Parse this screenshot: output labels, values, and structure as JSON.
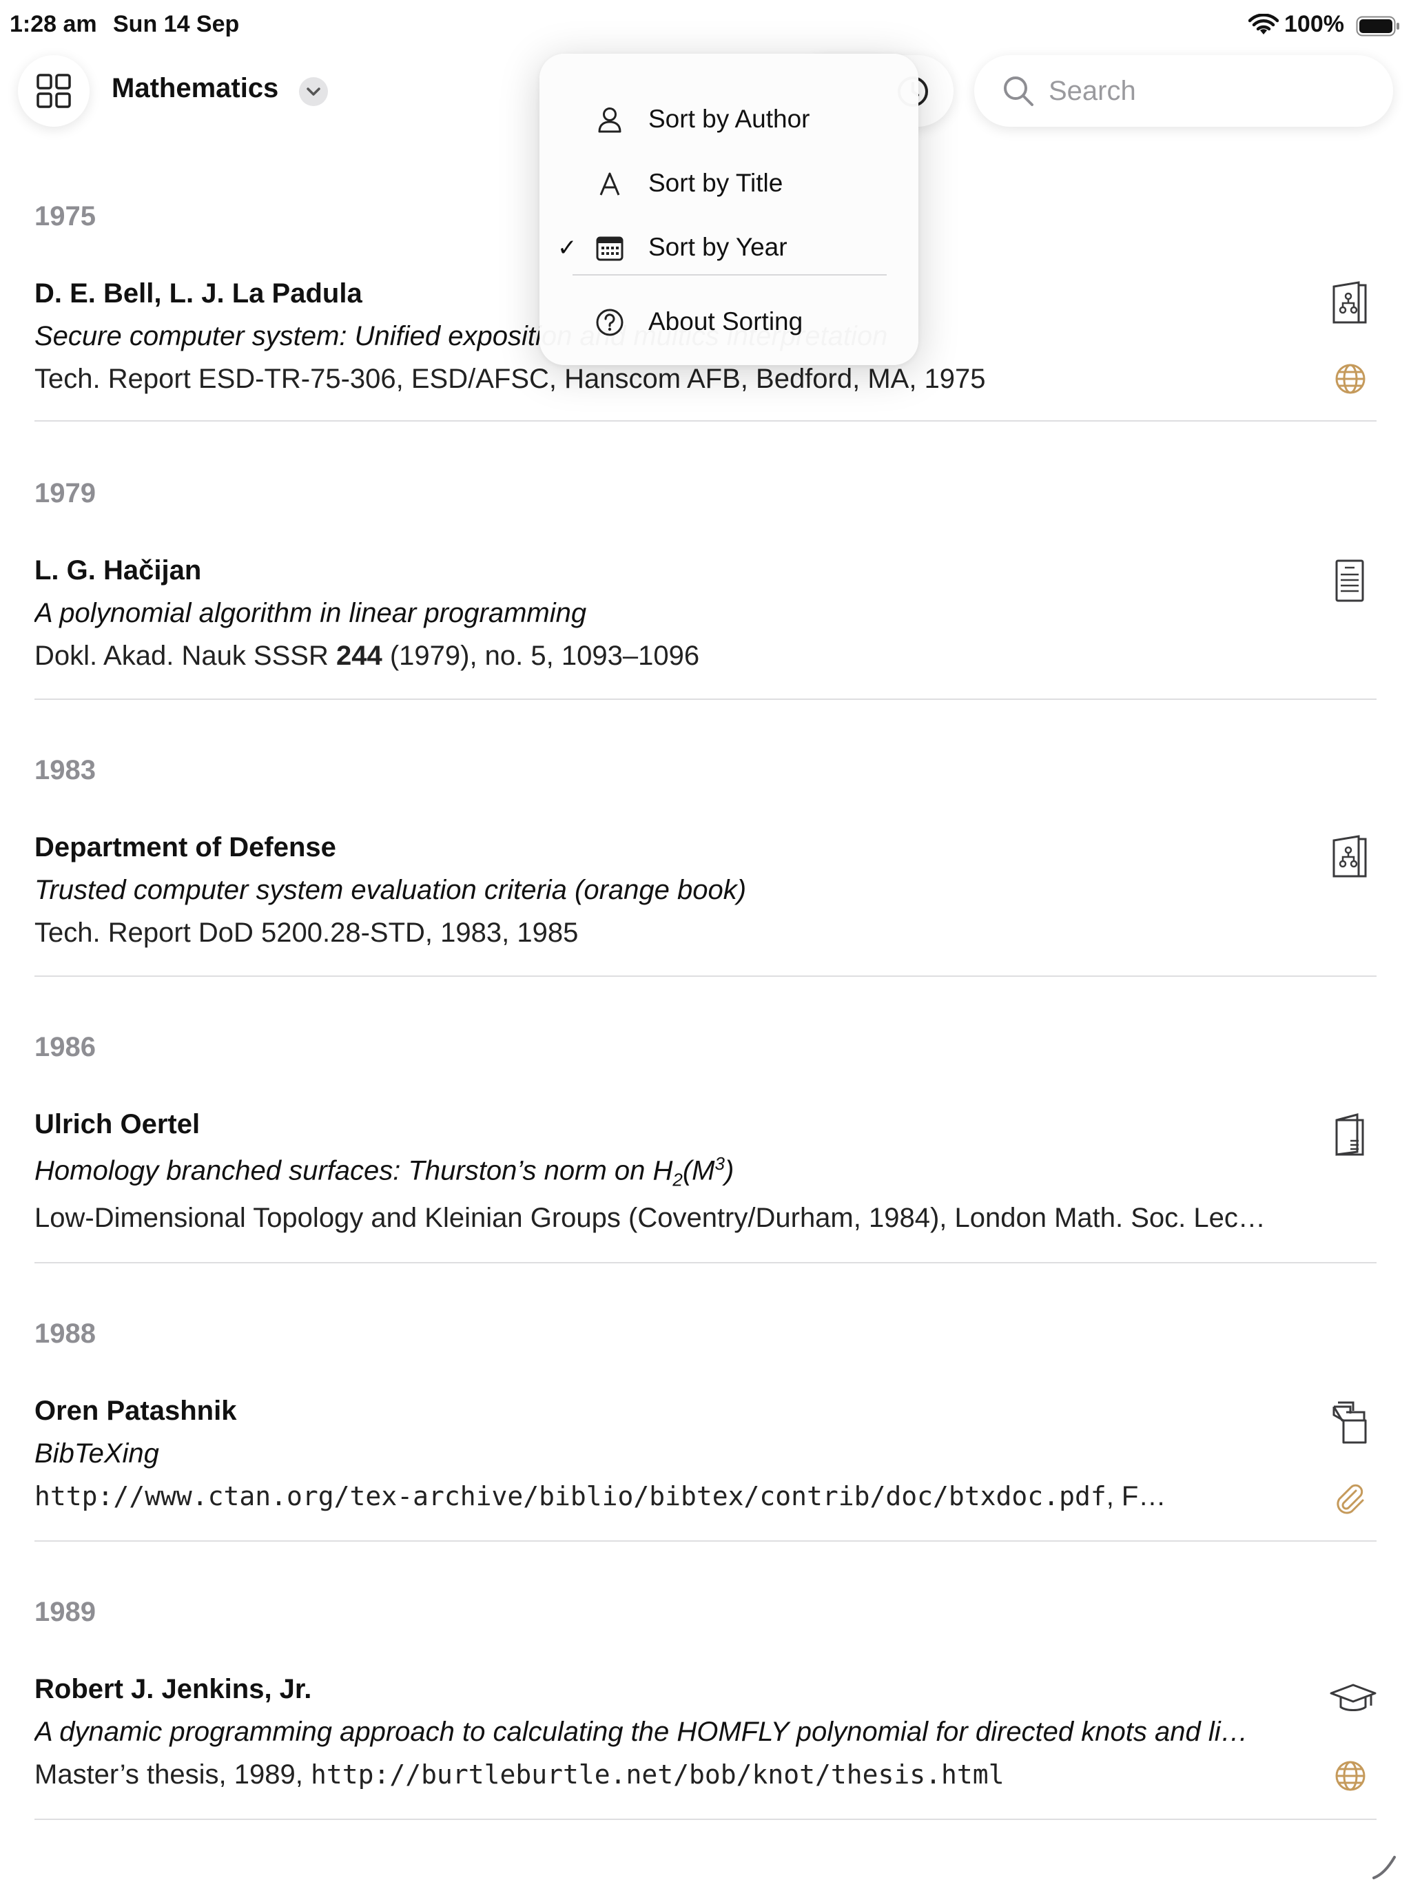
{
  "status_bar": {
    "time": "1:28 am",
    "date": "Sun 14 Sep",
    "battery": "100%"
  },
  "toolbar": {
    "collection_title": "Mathematics",
    "search_placeholder": "Search"
  },
  "sort_menu": {
    "items": [
      {
        "label": "Sort by Author",
        "icon": "person-icon",
        "checked": false
      },
      {
        "label": "Sort by Title",
        "icon": "letter-a-icon",
        "checked": false
      },
      {
        "label": "Sort by Year",
        "icon": "calendar-icon",
        "checked": true
      }
    ],
    "about_label": "About Sorting",
    "check_glyph": "✓"
  },
  "sections": [
    {
      "year": "1975",
      "entries": [
        {
          "author": "D. E. Bell, L. J. La Padula",
          "title": "Secure computer system: Unified exposition and multics interpretation",
          "detail": "Tech. Report ESD-TR-75-306, ESD/AFSC, Hanscom AFB, Bedford, MA, 1975",
          "type_icon": "report-icon",
          "link_icon": "globe-icon"
        }
      ]
    },
    {
      "year": "1979",
      "entries": [
        {
          "author": "L. G. Hačijan",
          "title": "A polynomial algorithm in linear programming",
          "detail_prefix": "Dokl. Akad. Nauk SSSR ",
          "detail_bold": "244",
          "detail_suffix": " (1979), no. 5, 1093–1096",
          "type_icon": "article-icon"
        }
      ]
    },
    {
      "year": "1983",
      "entries": [
        {
          "author": "Department of Defense",
          "title": "Trusted computer system evaluation criteria (orange book)",
          "detail": "Tech. Report DoD 5200.28-STD, 1983, 1985",
          "type_icon": "report-icon"
        }
      ]
    },
    {
      "year": "1986",
      "entries": [
        {
          "author": "Ulrich Oertel",
          "title_prefix": "Homology branched surfaces: Thurston’s norm on H",
          "title_sub": "2",
          "title_mid": "(M",
          "title_sup": "3",
          "title_suffix": ")",
          "detail": "Low-Dimensional Topology and Kleinian Groups (Coventry/Durham, 1984), London Math. Soc. Lec…",
          "type_icon": "book-chapter-icon"
        }
      ]
    },
    {
      "year": "1988",
      "entries": [
        {
          "author": "Oren Patashnik",
          "title": "BibTeXing",
          "detail_mono": "http://www.ctan.org/tex-archive/biblio/bibtex/contrib/doc/btxdoc.pdf",
          "detail_suffix": ", F…",
          "type_icon": "misc-icon",
          "link_icon": "paperclip-icon"
        }
      ]
    },
    {
      "year": "1989",
      "entries": [
        {
          "author": "Robert J. Jenkins, Jr.",
          "title": "A dynamic programming approach to calculating the HOMFLY polynomial for directed knots and li…",
          "detail_prefix": "Master’s thesis, 1989, ",
          "detail_mono": "http://burtleburtle.net/bob/knot/thesis.html",
          "type_icon": "graduation-cap-icon",
          "link_icon": "globe-icon"
        }
      ]
    }
  ],
  "colors": {
    "section_header": "#8e8e93",
    "link_accent": "#c59a5b",
    "icon_stroke": "#3a3a3c"
  }
}
